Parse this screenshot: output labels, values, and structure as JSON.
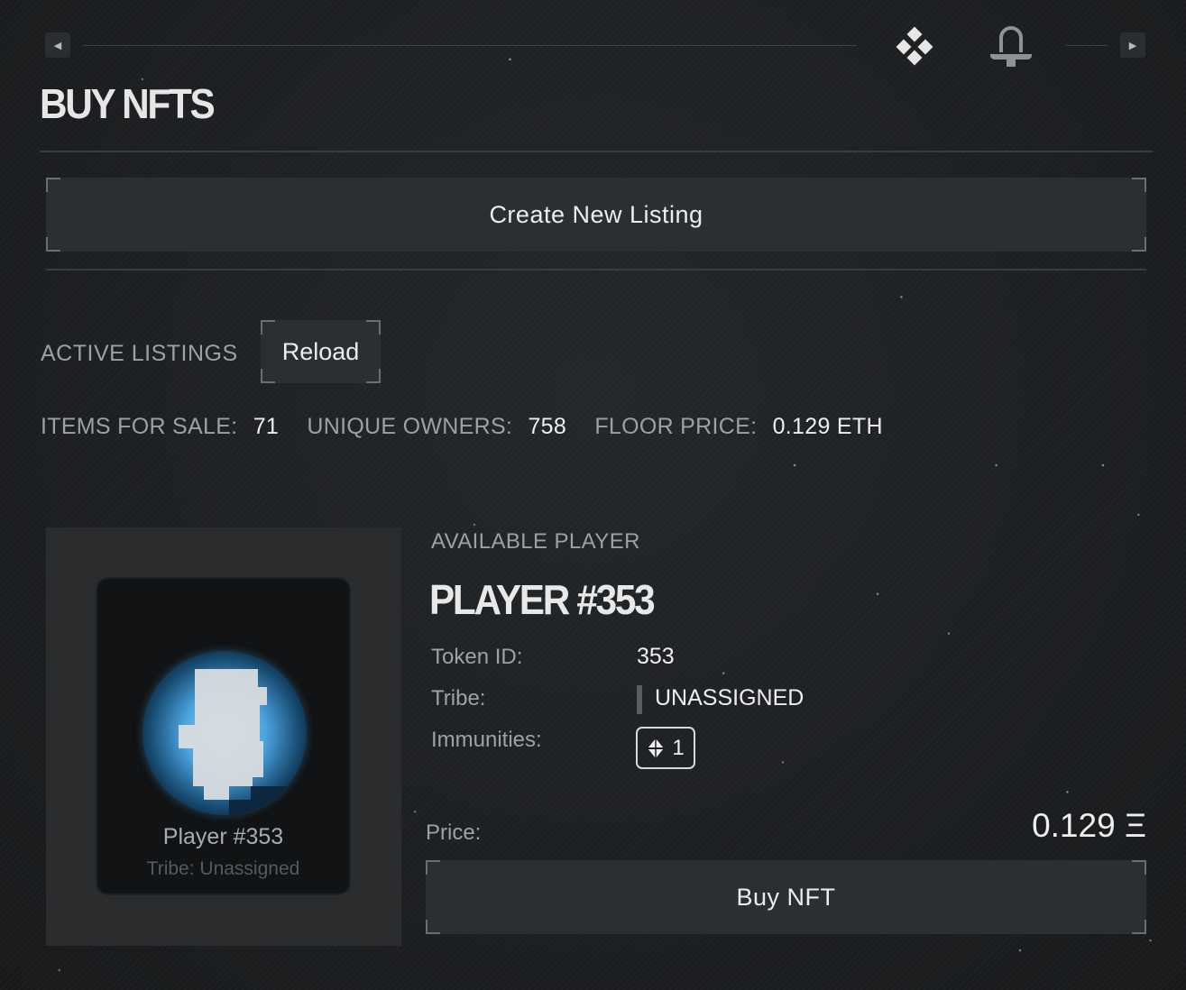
{
  "page": {
    "title": "BUY NFTS"
  },
  "nav": {
    "prev_icon": "triangle-left-icon",
    "next_icon": "triangle-right-icon",
    "icons": [
      "diamond-cluster-icon",
      "bell-helmet-icon"
    ]
  },
  "actions": {
    "create_listing_label": "Create New Listing"
  },
  "listings": {
    "section_label": "ACTIVE LISTINGS",
    "reload_label": "Reload"
  },
  "stats": {
    "items_for_sale_label": "ITEMS FOR SALE:",
    "items_for_sale_value": "71",
    "unique_owners_label": "UNIQUE OWNERS:",
    "unique_owners_value": "758",
    "floor_price_label": "FLOOR PRICE:",
    "floor_price_value": "0.129 ETH"
  },
  "listing": {
    "eyebrow": "AVAILABLE PLAYER",
    "name": "PLAYER #353",
    "card_name": "Player #353",
    "card_tribe": "Tribe: Unassigned",
    "token_id_label": "Token ID:",
    "token_id_value": "353",
    "tribe_label": "Tribe:",
    "tribe_value": "UNASSIGNED",
    "immunities_label": "Immunities:",
    "immunities_value": "1",
    "price_label": "Price:",
    "price_value": "0.129 Ξ",
    "buy_label": "Buy NFT"
  },
  "colors": {
    "background": "#1b1d1f",
    "panel": "#2c2f32",
    "avatar_glow": "#4da4e0"
  }
}
